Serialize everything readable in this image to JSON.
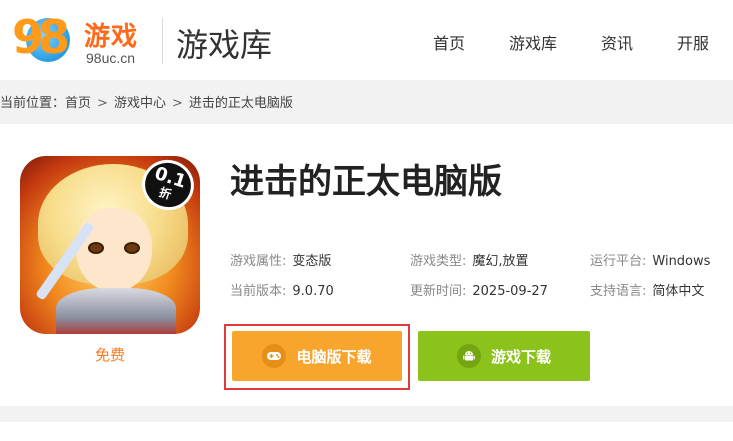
{
  "header": {
    "logo_digits": "98",
    "logo_text": "游戏",
    "logo_url": "98uc.cn",
    "site_title": "游戏库",
    "nav": [
      {
        "label": "首页"
      },
      {
        "label": "游戏库"
      },
      {
        "label": "资讯"
      },
      {
        "label": "开服"
      }
    ]
  },
  "breadcrumb": {
    "prefix": "当前位置：",
    "items": [
      "首页",
      "游戏中心",
      "进击的正太电脑版"
    ],
    "separator": ">"
  },
  "game": {
    "title": "进击的正太电脑版",
    "price_label": "免费",
    "discount_badge": {
      "value": "0.1",
      "unit": "折"
    },
    "info": [
      {
        "key": "游戏属性:",
        "value": "变态版"
      },
      {
        "key": "游戏类型:",
        "value": "魔幻,放置"
      },
      {
        "key": "运行平台:",
        "value": "Windows"
      },
      {
        "key": "当前版本:",
        "value": "9.0.70"
      },
      {
        "key": "更新时间:",
        "value": "2025-09-27"
      },
      {
        "key": "支持语言:",
        "value": "简体中文"
      }
    ],
    "buttons": {
      "pc_download": "电脑版下载",
      "android_download": "游戏下载"
    }
  },
  "colors": {
    "accent_orange": "#f7a52d",
    "accent_green": "#8bc21c",
    "highlight_border": "#e03a3a",
    "price_orange": "#ff7a1f"
  }
}
